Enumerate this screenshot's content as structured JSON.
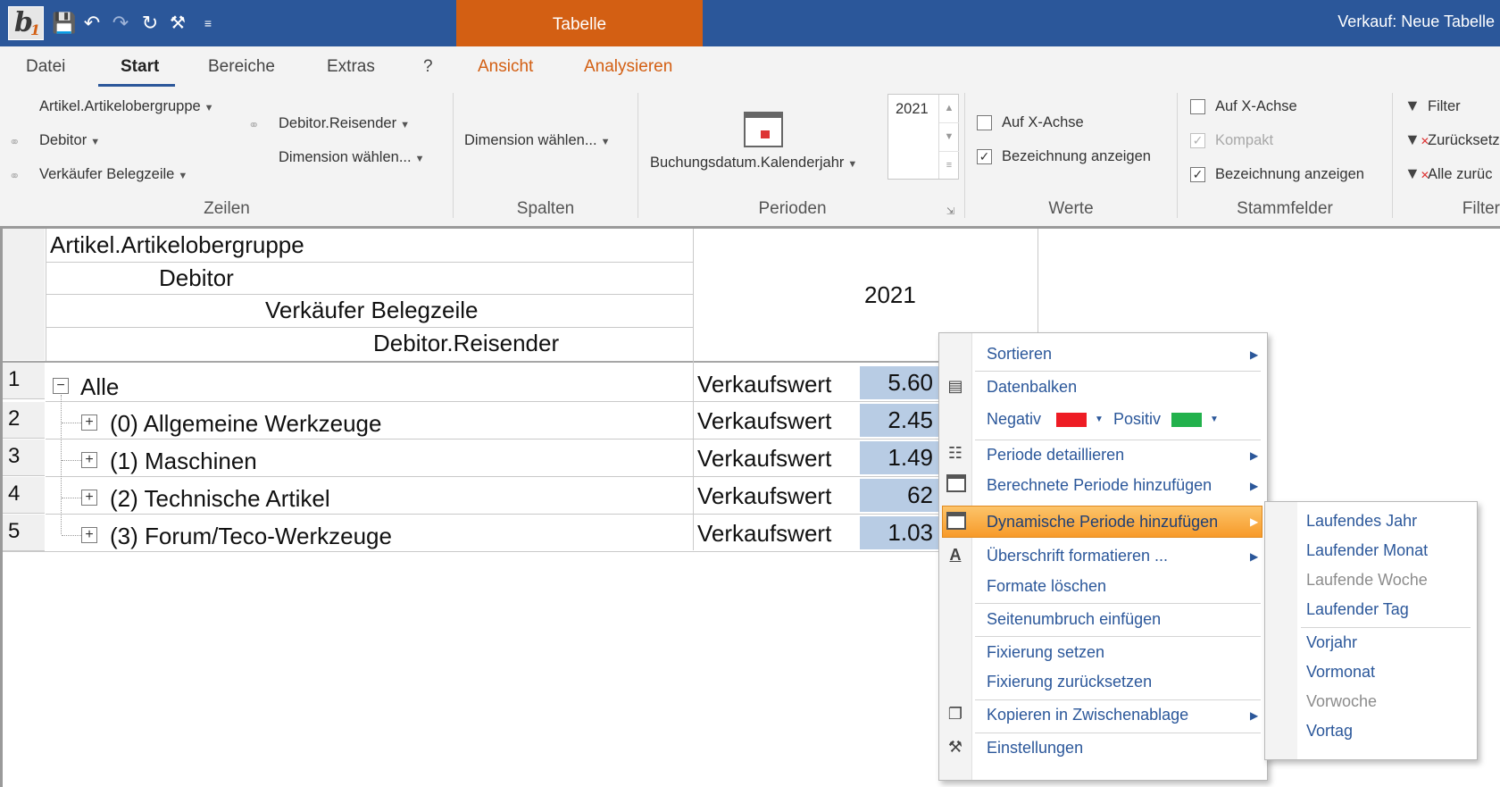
{
  "window": {
    "context_tab": "Tabelle",
    "title": "Verkauf: Neue Tabelle"
  },
  "quick_access": [
    "save-icon",
    "undo-icon",
    "redo-icon",
    "refresh-icon",
    "tools-icon",
    "customize-icon"
  ],
  "tabs": [
    {
      "label": "Datei"
    },
    {
      "label": "Start"
    },
    {
      "label": "Bereiche"
    },
    {
      "label": "Extras"
    },
    {
      "label": "?"
    },
    {
      "label": "Ansicht"
    },
    {
      "label": "Analysieren"
    }
  ],
  "ribbon": {
    "zeilen": {
      "group": "Zeilen",
      "items": [
        "Artikel.Artikelobergruppe",
        "Debitor",
        "Verkäufer Belegzeile",
        "Debitor.Reisender",
        "Dimension wählen..."
      ]
    },
    "spalten": {
      "group": "Spalten",
      "dimension": "Dimension wählen..."
    },
    "perioden": {
      "group": "Perioden",
      "dimension": "Buchungsdatum.Kalenderjahr",
      "year": "2021"
    },
    "werte": {
      "group": "Werte",
      "x_axis": "Auf X-Achse",
      "show_label": "Bezeichnung anzeigen"
    },
    "stammfelder": {
      "group": "Stammfelder",
      "x_axis": "Auf X-Achse",
      "compact": "Kompakt",
      "show_label": "Bezeichnung anzeigen"
    },
    "filter": {
      "group": "Filter",
      "filter": "Filter",
      "reset": "Zurücksetz",
      "reset_all": "Alle zurüc"
    }
  },
  "grid": {
    "header_dims": [
      "Artikel.Artikelobergruppe",
      "Debitor",
      "Verkäufer Belegzeile",
      "Debitor.Reisender"
    ],
    "period": "2021",
    "rows": [
      {
        "num": "1",
        "label": "Alle",
        "measure": "Verkaufswert",
        "value": "5.60"
      },
      {
        "num": "2",
        "label": "(0) Allgemeine Werkzeuge",
        "measure": "Verkaufswert",
        "value": "2.45"
      },
      {
        "num": "3",
        "label": "(1) Maschinen",
        "measure": "Verkaufswert",
        "value": "1.49"
      },
      {
        "num": "4",
        "label": "(2) Technische Artikel",
        "measure": "Verkaufswert",
        "value": "62"
      },
      {
        "num": "5",
        "label": "(3) Forum/Teco-Werkzeuge",
        "measure": "Verkaufswert",
        "value": "1.03"
      }
    ]
  },
  "context_menu": {
    "sort": "Sortieren",
    "databars": "Datenbalken",
    "negative": "Negativ",
    "positive": "Positiv",
    "negative_color": "#ee1c24",
    "positive_color": "#22b14c",
    "detail_period": "Periode detaillieren",
    "calc_period": "Berechnete Periode hinzufügen",
    "dyn_period": "Dynamische Periode hinzufügen",
    "format_heading": "Überschrift formatieren ...",
    "clear_formats": "Formate löschen",
    "page_break": "Seitenumbruch einfügen",
    "freeze": "Fixierung setzen",
    "unfreeze": "Fixierung zurücksetzen",
    "copy": "Kopieren in Zwischenablage",
    "settings": "Einstellungen"
  },
  "submenu": {
    "current_year": "Laufendes Jahr",
    "current_month": "Laufender Monat",
    "current_week": "Laufende Woche",
    "current_day": "Laufender Tag",
    "prev_year": "Vorjahr",
    "prev_month": "Vormonat",
    "prev_week": "Vorwoche",
    "prev_day": "Vortag"
  }
}
